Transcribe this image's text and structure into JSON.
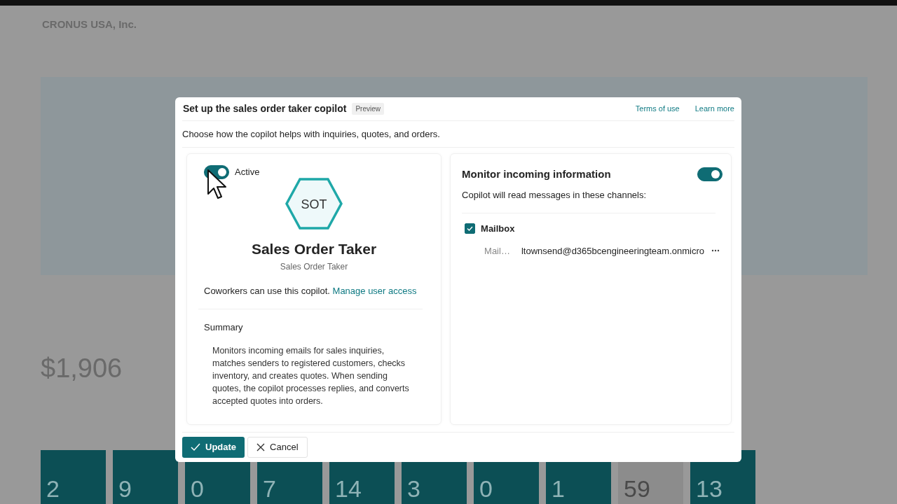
{
  "background": {
    "company": "CRONUS USA, Inc.",
    "amount": "$1,906",
    "tiles": [
      {
        "value": "2",
        "color": "#0c4f55"
      },
      {
        "value": "9",
        "color": "#0c4f55"
      },
      {
        "value": "0",
        "color": "#0c4f55"
      },
      {
        "value": "7",
        "color": "#0c4f55"
      },
      {
        "value": "14",
        "color": "#0c4f55"
      },
      {
        "value": "3",
        "color": "#0c4f55"
      },
      {
        "value": "0",
        "color": "#0c4f55"
      },
      {
        "value": "1",
        "color": "#0c4f55"
      },
      {
        "value": "59",
        "color": "#8c8c8c"
      },
      {
        "value": "13",
        "color": "#0c4f55"
      }
    ]
  },
  "dialog": {
    "title": "Set up the sales order taker copilot",
    "badge": "Preview",
    "links": [
      "Terms of use",
      "Learn more"
    ],
    "description": "Choose how the copilot helps with inquiries, quotes, and orders.",
    "agent": {
      "active": {
        "label": "Active",
        "on": true
      },
      "initials": "SOT",
      "name": "Sales Order Taker",
      "subtitle": "Sales Order Taker",
      "access_text": "Coworkers can use this copilot.",
      "access_link": "Manage user access",
      "summary_label": "Summary",
      "summary": "Monitors incoming emails for sales inquiries, matches senders to registered customers, checks inventory, and creates quotes. When sending quotes, the copilot processes replies, and converts accepted quotes into orders."
    },
    "monitor": {
      "title": "Monitor incoming information",
      "on": true,
      "hint": "Copilot will read messages in these channels:",
      "channels": [
        {
          "name": "Mailbox",
          "checked": true,
          "field_label": "Mail…",
          "address": "ltownsend@d365bcengineeringteam.onmicro"
        }
      ]
    },
    "buttons": [
      {
        "label": "Update",
        "kind": "primary"
      },
      {
        "label": "Cancel",
        "kind": "secondary"
      }
    ]
  }
}
